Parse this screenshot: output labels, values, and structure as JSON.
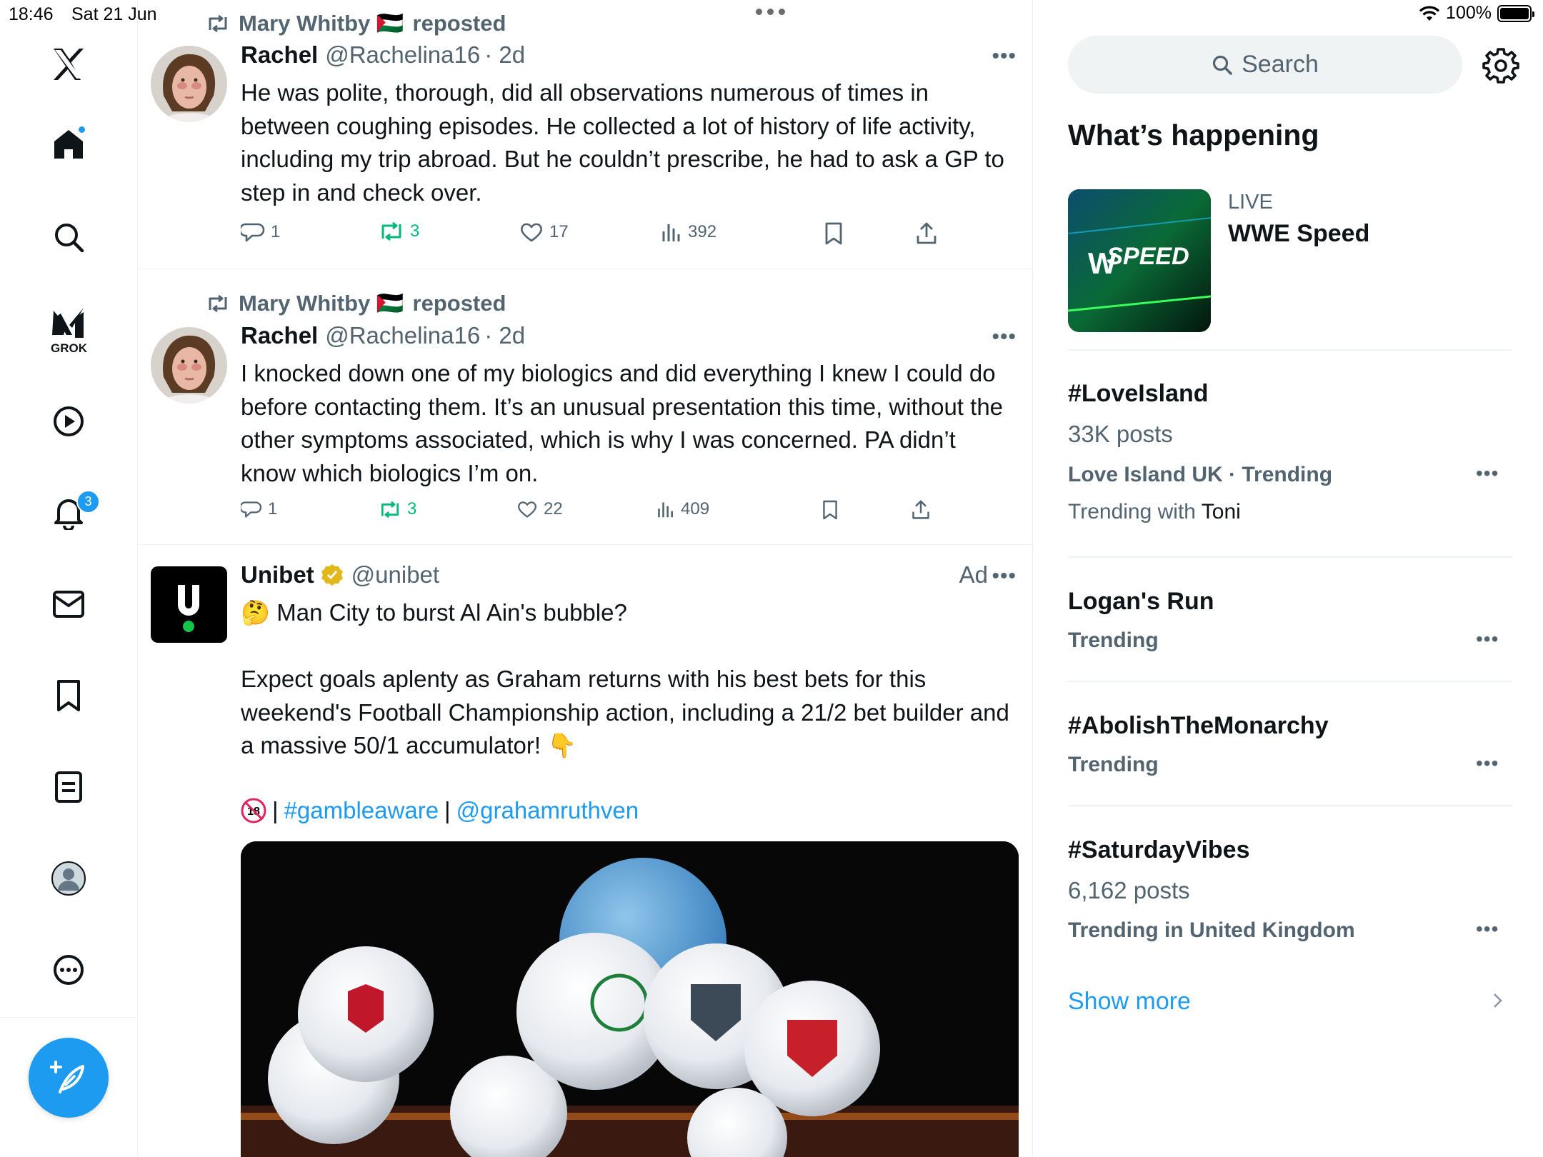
{
  "status_bar": {
    "time": "18:46",
    "date": "Sat 21 Jun",
    "battery": "100%"
  },
  "nav": {
    "items": [
      "x-logo",
      "home",
      "explore",
      "grok",
      "video",
      "notifications",
      "messages",
      "bookmarks",
      "lists",
      "profile",
      "more"
    ],
    "grok_label": "GROK",
    "notifications_badge": "3",
    "accent_color": "#1d9bf0"
  },
  "feed": {
    "tweets": [
      {
        "reposted_by": "Mary Whitby 🇵🇸",
        "reposted_label": "reposted",
        "name": "Rachel",
        "handle": "@Rachelina16",
        "time": "· 2d",
        "text": "He was polite, thorough, did all observations numerous of times in between coughing episodes. He collected a lot of history of life activity, including my trip abroad. But he couldn’t prescribe, he had to ask a GP to step in and check over.",
        "replies": "1",
        "reposts": "3",
        "likes": "17",
        "views": "392"
      },
      {
        "reposted_by": "Mary Whitby 🇵🇸",
        "reposted_label": "reposted",
        "name": "Rachel",
        "handle": "@Rachelina16",
        "time": "· 2d",
        "text": "I knocked down one of my biologics and did everything I knew I could do before contacting them. It’s an unusual presentation this time, without the other symptoms associated, which is why I was concerned. PA didn’t know which biologics I’m on.",
        "replies": "1",
        "reposts": "3",
        "likes": "22",
        "views": "409"
      }
    ],
    "ad": {
      "name": "Unibet",
      "handle": "@unibet",
      "ad_label": "Ad",
      "line1": "🤔 Man City to burst Al Ain's bubble?",
      "body": "Expect goals aplenty as Graham returns with his best bets for this weekend's Football Championship action, including a 21/2 bet builder and a massive 50/1 accumulator! 👇",
      "footer_sep1": "|",
      "hashtag": "#gambleaware",
      "footer_sep2": "|",
      "mention": "@grahamruthven"
    }
  },
  "sidebar": {
    "search_placeholder": "Search",
    "section_title": "What’s happening",
    "live": {
      "label": "LIVE",
      "title": "WWE Speed",
      "thumb_text": "SPEED"
    },
    "trends": [
      {
        "title": "#LoveIsland",
        "posts": "33K posts",
        "meta": "Love Island UK · Trending",
        "with_prefix": "Trending with",
        "with_name": "Toni"
      },
      {
        "title": "Logan's Run",
        "meta": "Trending"
      },
      {
        "title": "#AbolishTheMonarchy",
        "meta": "Trending"
      },
      {
        "title": "#SaturdayVibes",
        "posts": "6,162 posts",
        "meta": "Trending in United Kingdom"
      }
    ],
    "show_more": "Show more"
  }
}
